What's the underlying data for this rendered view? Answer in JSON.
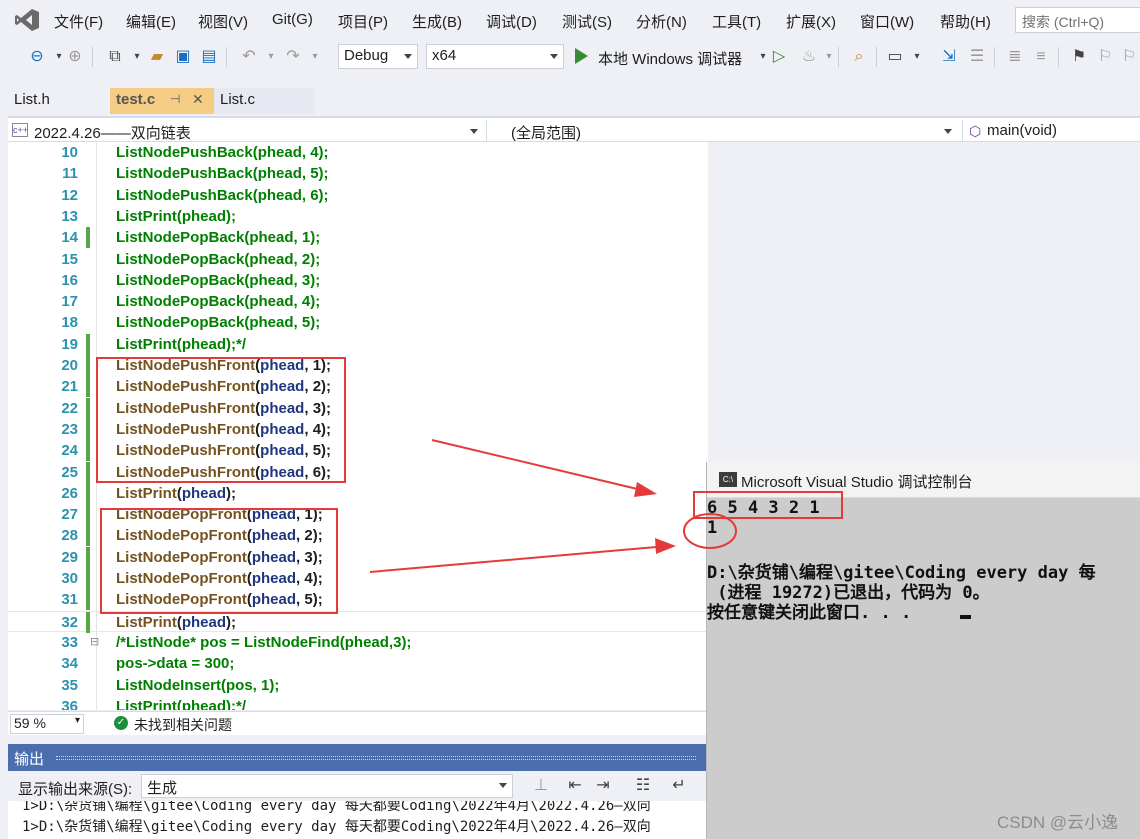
{
  "menu": {
    "items": [
      "文件(F)",
      "编辑(E)",
      "视图(V)",
      "Git(G)",
      "项目(P)",
      "生成(B)",
      "调试(D)",
      "测试(S)",
      "分析(N)",
      "工具(T)",
      "扩展(X)",
      "窗口(W)",
      "帮助(H)"
    ],
    "search_placeholder": "搜索 (Ctrl+Q)"
  },
  "toolbar": {
    "configuration": "Debug",
    "platform": "x64",
    "run_label": "本地 Windows 调试器"
  },
  "tabs": [
    {
      "label": "List.h",
      "active": false
    },
    {
      "label": "test.c",
      "active": true,
      "pinned_icon": "⊣",
      "close_icon": "✕"
    },
    {
      "label": "List.c",
      "active": false
    }
  ],
  "navbar": {
    "project": "2022.4.26——双向链表",
    "scope": "(全局范围)",
    "member": "main(void)"
  },
  "code": [
    {
      "n": "10",
      "text": "ListNodePushBack(phead, 4);",
      "style": "comment"
    },
    {
      "n": "11",
      "text": "ListNodePushBack(phead, 5);",
      "style": "comment"
    },
    {
      "n": "12",
      "text": "ListNodePushBack(phead, 6);",
      "style": "comment"
    },
    {
      "n": "13",
      "text": "ListPrint(phead);",
      "style": "comment"
    },
    {
      "n": "14",
      "text": "ListNodePopBack(phead, 1);",
      "style": "comment",
      "changed": true
    },
    {
      "n": "15",
      "text": "ListNodePopBack(phead, 2);",
      "style": "comment"
    },
    {
      "n": "16",
      "text": "ListNodePopBack(phead, 3);",
      "style": "comment"
    },
    {
      "n": "17",
      "text": "ListNodePopBack(phead, 4);",
      "style": "comment"
    },
    {
      "n": "18",
      "text": "ListNodePopBack(phead, 5);",
      "style": "comment"
    },
    {
      "n": "19",
      "text": "ListPrint(phead);*/",
      "style": "comment",
      "changed": true
    },
    {
      "n": "20",
      "fn": "ListNodePushFront",
      "arg": "phead",
      "rest": ", 1);",
      "style": "code",
      "changed": true
    },
    {
      "n": "21",
      "fn": "ListNodePushFront",
      "arg": "phead",
      "rest": ", 2);",
      "style": "code",
      "changed": true
    },
    {
      "n": "22",
      "fn": "ListNodePushFront",
      "arg": "phead",
      "rest": ", 3);",
      "style": "code",
      "changed": true
    },
    {
      "n": "23",
      "fn": "ListNodePushFront",
      "arg": "phead",
      "rest": ", 4);",
      "style": "code",
      "changed": true
    },
    {
      "n": "24",
      "fn": "ListNodePushFront",
      "arg": "phead",
      "rest": ", 5);",
      "style": "code",
      "changed": true
    },
    {
      "n": "25",
      "fn": "ListNodePushFront",
      "arg": "phead",
      "rest": ", 6);",
      "style": "code",
      "changed": true
    },
    {
      "n": "26",
      "fn": "ListPrint",
      "arg": "phead",
      "rest": ");",
      "style": "code",
      "changed": true
    },
    {
      "n": "27",
      "fn": "ListNodePopFront",
      "arg": "phead",
      "rest": ", 1);",
      "style": "code",
      "changed": true
    },
    {
      "n": "28",
      "fn": "ListNodePopFront",
      "arg": "phead",
      "rest": ", 2);",
      "style": "code",
      "changed": true
    },
    {
      "n": "29",
      "fn": "ListNodePopFront",
      "arg": "phead",
      "rest": ", 3);",
      "style": "code",
      "changed": true
    },
    {
      "n": "30",
      "fn": "ListNodePopFront",
      "arg": "phead",
      "rest": ", 4);",
      "style": "code",
      "changed": true
    },
    {
      "n": "31",
      "fn": "ListNodePopFront",
      "arg": "phead",
      "rest": ", 5);",
      "style": "code",
      "changed": true
    },
    {
      "n": "32",
      "fn": "ListPrint",
      "arg": "phead",
      "rest": ");",
      "style": "code",
      "changed": true
    },
    {
      "n": "33",
      "text": "/*ListNode* pos = ListNodeFind(phead,3);",
      "style": "comment",
      "fold": "⊟"
    },
    {
      "n": "34",
      "text": "pos->data = 300;",
      "style": "comment"
    },
    {
      "n": "35",
      "text": "ListNodeInsert(pos, 1);",
      "style": "comment"
    },
    {
      "n": "36",
      "text": "ListPrint(phead);*/",
      "style": "comment"
    }
  ],
  "status": {
    "zoom": "59 %",
    "message": "未找到相关问题"
  },
  "output": {
    "title": "输出",
    "source_label": "显示输出来源(S):",
    "source_value": "生成",
    "lines": [
      "1>D:\\杂货铺\\编程\\gitee\\Coding every day 每天都要Coding\\2022年4月\\2022.4.26—双向",
      "1>D:\\杂货铺\\编程\\gitee\\Coding every day 每天都要Coding\\2022年4月\\2022.4.26—双向"
    ]
  },
  "console": {
    "icon_label": "C:\\",
    "title": "Microsoft Visual Studio 调试控制台",
    "lines": [
      "6 5 4 3 2 1",
      "1",
      "",
      "D:\\杂货铺\\编程\\gitee\\Coding every day 每",
      " (进程 19272)已退出，代码为 0。",
      "按任意键关闭此窗口. . ."
    ]
  },
  "watermark": "CSDN @云小逸",
  "colors": {
    "highlight": "#e53a3a",
    "comment": "#008000",
    "function": "#74531f",
    "param": "#1f377f",
    "line_number": "#2b91af",
    "output_header": "#4b6eaf",
    "console_bg": "#cccccc"
  }
}
